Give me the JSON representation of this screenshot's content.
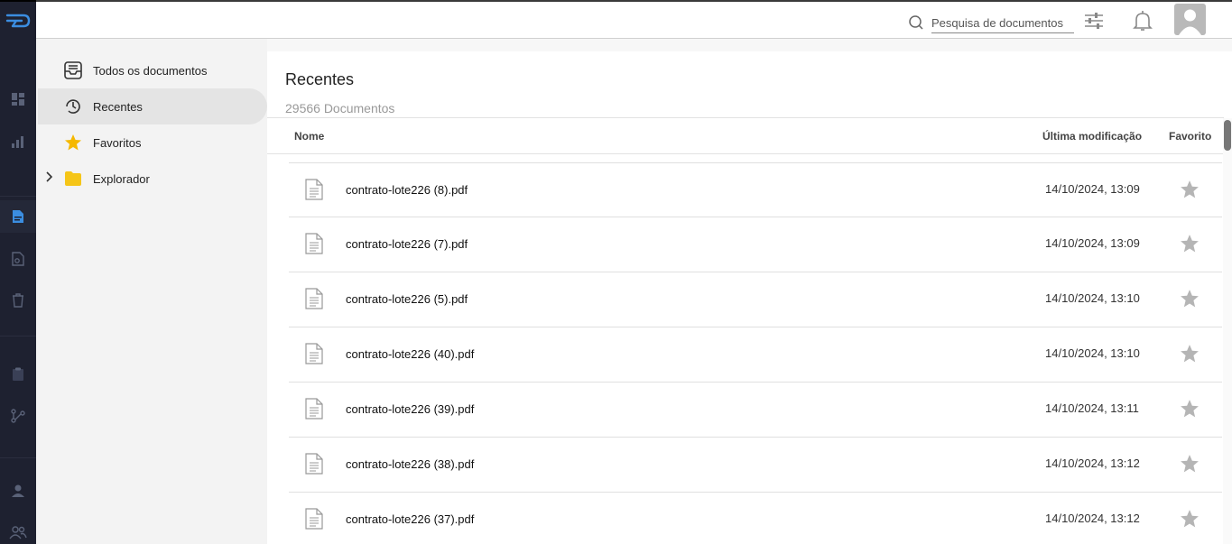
{
  "rail": {
    "items": [
      {
        "name": "dashboard",
        "icon": "dashboard-icon"
      },
      {
        "name": "reports",
        "icon": "bar-chart-icon"
      },
      {
        "name": "documents",
        "icon": "document-icon",
        "active": true
      },
      {
        "name": "document-settings",
        "icon": "document-gear-icon"
      },
      {
        "name": "trash",
        "icon": "trash-icon"
      },
      {
        "name": "clipboard",
        "icon": "clipboard-icon"
      },
      {
        "name": "workflow",
        "icon": "workflow-icon"
      },
      {
        "name": "user",
        "icon": "user-icon"
      },
      {
        "name": "groups",
        "icon": "groups-icon"
      }
    ],
    "accent": "#3b8de0"
  },
  "topbar": {
    "search_placeholder": "Pesquisa de documentos"
  },
  "sidebar": {
    "items": [
      {
        "label": "Todos os documentos",
        "icon": "inbox-icon"
      },
      {
        "label": "Recentes",
        "icon": "history-icon",
        "active": true
      },
      {
        "label": "Favoritos",
        "icon": "star-icon"
      },
      {
        "label": "Explorador",
        "icon": "folder-icon"
      }
    ],
    "favorite_color": "#f5b800",
    "folder_color": "#f5c518"
  },
  "main": {
    "title": "Recentes",
    "count": "29566 Documentos",
    "columns": {
      "name": "Nome",
      "modified": "Última modificação",
      "favorite": "Favorito"
    },
    "rows": [
      {
        "name": "contrato-lote226 (8).pdf",
        "modified": "14/10/2024, 13:09"
      },
      {
        "name": "contrato-lote226 (7).pdf",
        "modified": "14/10/2024, 13:09"
      },
      {
        "name": "contrato-lote226 (5).pdf",
        "modified": "14/10/2024, 13:10"
      },
      {
        "name": "contrato-lote226 (40).pdf",
        "modified": "14/10/2024, 13:10"
      },
      {
        "name": "contrato-lote226 (39).pdf",
        "modified": "14/10/2024, 13:11"
      },
      {
        "name": "contrato-lote226 (38).pdf",
        "modified": "14/10/2024, 13:12"
      },
      {
        "name": "contrato-lote226 (37).pdf",
        "modified": "14/10/2024, 13:12"
      }
    ]
  }
}
